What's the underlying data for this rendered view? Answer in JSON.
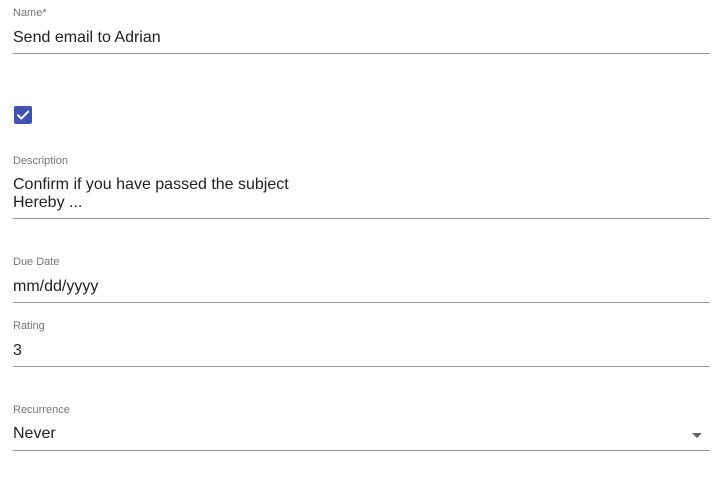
{
  "form": {
    "name": {
      "label": "Name*",
      "value": "Send email to Adrian"
    },
    "completed": {
      "checked": true,
      "accent_color": "#3f51b5",
      "icon": "check-icon"
    },
    "description": {
      "label": "Description",
      "lines": [
        "Confirm if you have passed the subject",
        "Hereby ..."
      ]
    },
    "due_date": {
      "label": "Due Date",
      "placeholder": "mm/dd/yyyy"
    },
    "rating": {
      "label": "Rating",
      "value": "3"
    },
    "recurrence": {
      "label": "Recurrence",
      "value": "Never",
      "icon": "chevron-down-icon"
    }
  }
}
